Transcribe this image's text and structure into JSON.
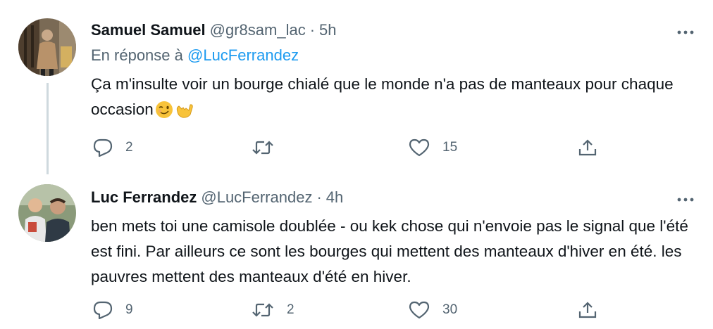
{
  "tweets": [
    {
      "name": "Samuel Samuel",
      "handle": "@gr8sam_lac",
      "separator": "·",
      "time": "5h",
      "replying_prefix": "En réponse à",
      "replying_to": "@LucFerrandez",
      "text": "Ça m'insulte voir un bourge chialé que le monde n'a pas de manteaux pour chaque occasion",
      "emojis": [
        "winking-face",
        "call-me-hand"
      ],
      "replies": "2",
      "retweets": "",
      "likes": "15"
    },
    {
      "name": "Luc Ferrandez",
      "handle": "@LucFerrandez",
      "separator": "·",
      "time": "4h",
      "text": "ben mets toi une camisole doublée - ou kek chose qui n'envoie pas le signal que l'été est fini. Par ailleurs ce sont les bourges qui mettent des manteaux d'hiver en été. les pauvres mettent des manteaux d'été en hiver.",
      "replies": "9",
      "retweets": "2",
      "likes": "30"
    }
  ],
  "colors": {
    "text": "#0f1419",
    "secondary": "#536471",
    "link": "#1d9bf0",
    "thread_line": "#cfd9de"
  },
  "icons": [
    "reply-icon",
    "retweet-icon",
    "like-icon",
    "share-icon",
    "more-icon"
  ]
}
